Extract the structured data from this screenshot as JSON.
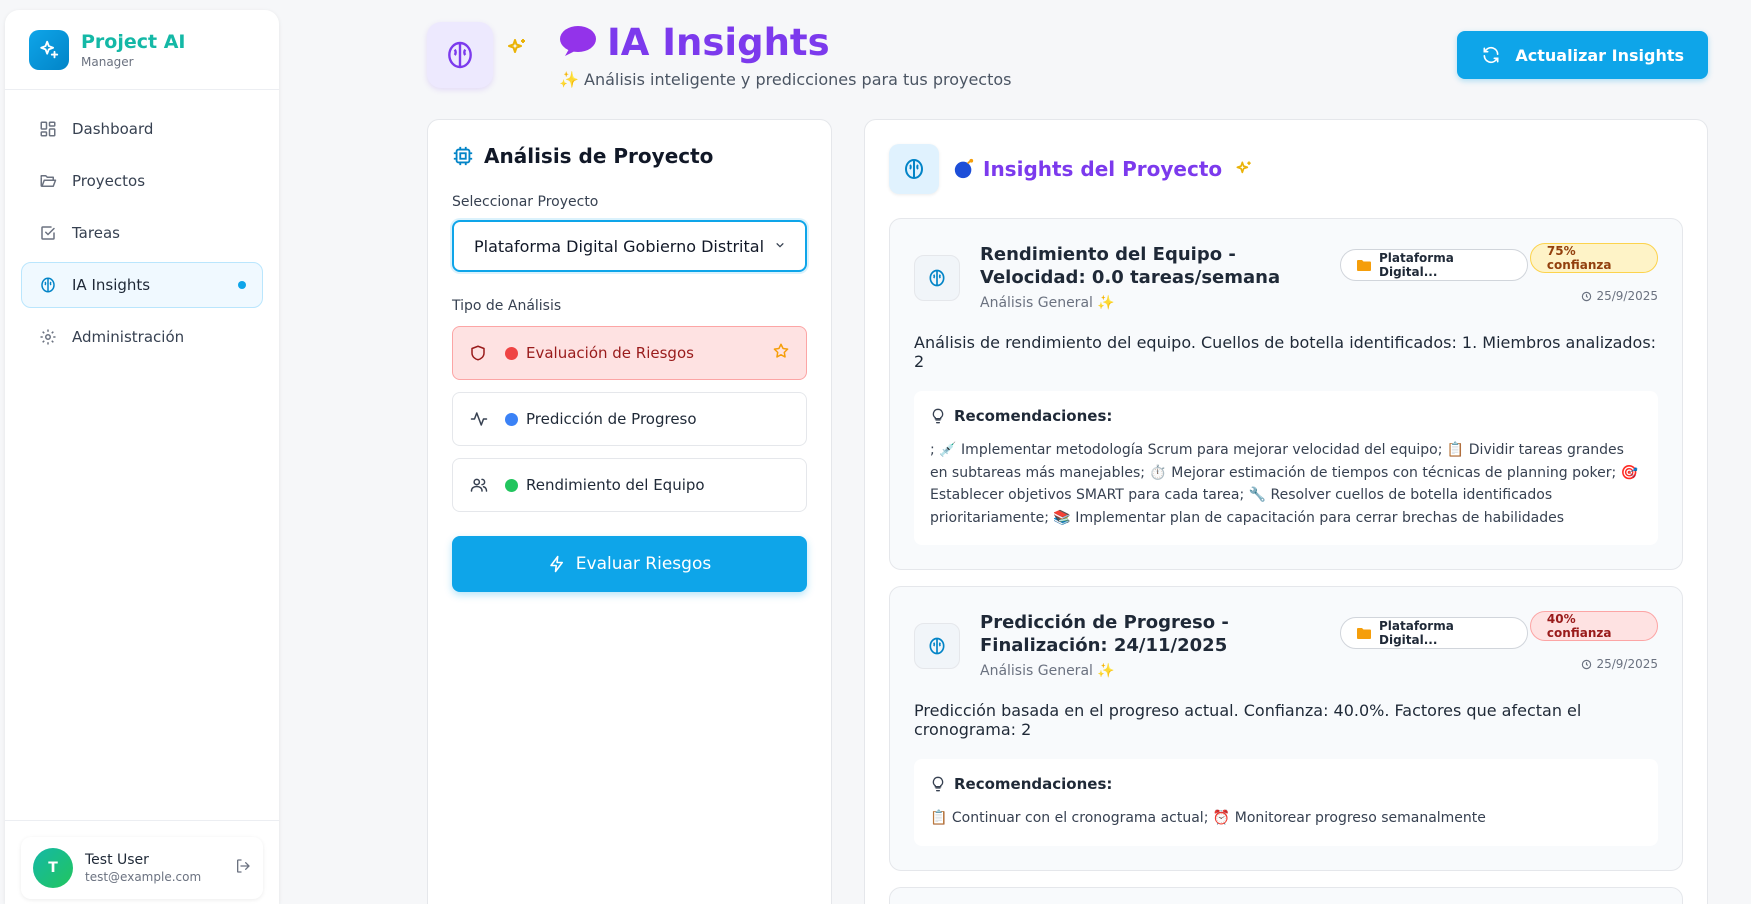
{
  "brand": {
    "title": "Project AI",
    "subtitle": "Manager"
  },
  "sidebar": {
    "items": [
      {
        "label": "Dashboard"
      },
      {
        "label": "Proyectos"
      },
      {
        "label": "Tareas"
      },
      {
        "label": "IA Insights"
      },
      {
        "label": "Administración"
      }
    ]
  },
  "user": {
    "initial": "T",
    "name": "Test User",
    "email": "test@example.com"
  },
  "header": {
    "title": "IA Insights",
    "subtitle": "✨ Análisis inteligente y predicciones para tus proyectos",
    "refresh_label": "Actualizar Insights"
  },
  "analysis": {
    "title": "Análisis de Proyecto",
    "select_label": "Seleccionar Proyecto",
    "selected_project": "Plataforma Digital Gobierno Distrital",
    "type_label": "Tipo de Análisis",
    "options": [
      {
        "label": "Evaluación de Riesgos",
        "dot_color": "#ef4444"
      },
      {
        "label": "Predicción de Progreso",
        "dot_color": "#3b82f6"
      },
      {
        "label": "Rendimiento del Equipo",
        "dot_color": "#22c55e"
      }
    ],
    "action_label": "Evaluar Riesgos"
  },
  "insights": {
    "title": "Insights del Proyecto",
    "cards": [
      {
        "title": "Rendimiento del Equipo - Velocidad: 0.0 tareas/semana",
        "category": "Análisis General",
        "project": "Plataforma Digital...",
        "confidence": "75% confianza",
        "date": "25/9/2025",
        "description": "Análisis de rendimiento del equipo. Cuellos de botella identificados: 1. Miembros analizados: 2",
        "recs_title": "Recomendaciones:",
        "recs_text": "; 💉 Implementar metodología Scrum para mejorar velocidad del equipo; 📋 Dividir tareas grandes en subtareas más manejables; ⏱️ Mejorar estimación de tiempos con técnicas de planning poker; 🎯 Establecer objetivos SMART para cada tarea; 🔧 Resolver cuellos de botella identificados prioritariamente; 📚 Implementar plan de capacitación para cerrar brechas de habilidades"
      },
      {
        "title": "Predicción de Progreso - Finalización: 24/11/2025",
        "category": "Análisis General",
        "project": "Plataforma Digital...",
        "confidence": "40% confianza",
        "date": "25/9/2025",
        "description": "Predicción basada en el progreso actual. Confianza: 40.0%. Factores que afectan el cronograma: 2",
        "recs_title": "Recomendaciones:",
        "recs_text": "📋 Continuar con el cronograma actual; ⏰ Monitorear progreso semanalmente"
      }
    ]
  },
  "colors": {
    "accent": "#0ea5e9",
    "brand_purple": "#7c3aed",
    "teal": "#14b8a6"
  }
}
